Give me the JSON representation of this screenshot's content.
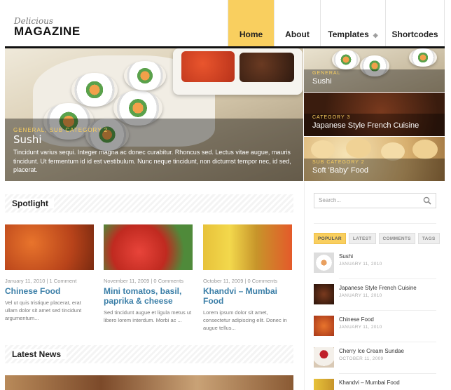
{
  "header": {
    "logo_script": "Delicious",
    "logo_main": "MAGAZINE",
    "nav": [
      {
        "label": "Home",
        "active": true
      },
      {
        "label": "About"
      },
      {
        "label": "Templates",
        "has_dropdown": true
      },
      {
        "label": "Shortcodes"
      }
    ]
  },
  "hero": {
    "category": "GENERAL, SUB CATEGORY 2",
    "title": "Sushi",
    "description": "Tincidunt varius sequi. Integer magna ac donec curabitur. Rhoncus sed. Lectus vitae augue, mauris tincidunt. Ut fermentum id id est vestibulum. Nunc neque tincidunt, non dictumst tempor nec, id sed, placerat."
  },
  "features": [
    {
      "category": "GENERAL",
      "title": "Sushi"
    },
    {
      "category": "CATEGORY 3",
      "title": "Japanese Style French Cuisine"
    },
    {
      "category": "SUB CATEGORY 2",
      "title": "Soft 'Baby' Food"
    }
  ],
  "spotlight": {
    "heading": "Spotlight",
    "cards": [
      {
        "meta": "January 11, 2010 | 1 Comment",
        "title": "Chinese Food",
        "text": "Vel ut quis tristique placerat, erat ullam dolor sit amet sed tincidunt argumentum..."
      },
      {
        "meta": "November 11, 2009 | 0 Comments",
        "title": "Mini tomatos, basil, paprika & cheese",
        "text": "Sed tincidunt augue et ligula metus ut libero lorem interdum. Morbi ac ..."
      },
      {
        "meta": "October 11, 2009 | 0 Comments",
        "title": "Khandvi – Mumbai Food",
        "text": "Lorem ipsum dolor sit amet, consectetur adipiscing elit. Donec in augue tellus..."
      }
    ]
  },
  "latest_news": {
    "heading": "Latest News"
  },
  "sidebar": {
    "search_placeholder": "Search...",
    "tabs": [
      {
        "label": "POPULAR",
        "active": true
      },
      {
        "label": "LATEST"
      },
      {
        "label": "COMMENTS"
      },
      {
        "label": "TAGS"
      }
    ],
    "posts": [
      {
        "title": "Sushi",
        "date": "JANUARY 11, 2010"
      },
      {
        "title": "Japanese Style French Cuisine",
        "date": "JANUARY 11, 2010"
      },
      {
        "title": "Chinese Food",
        "date": "JANUARY 11, 2010"
      },
      {
        "title": "Cherry Ice Cream Sundae",
        "date": "OCTOBER 11, 2009"
      },
      {
        "title": "Khandvi – Mumbai Food",
        "date": ""
      }
    ]
  },
  "colors": {
    "accent": "#f9cf5f",
    "link": "#3a7ea7"
  }
}
